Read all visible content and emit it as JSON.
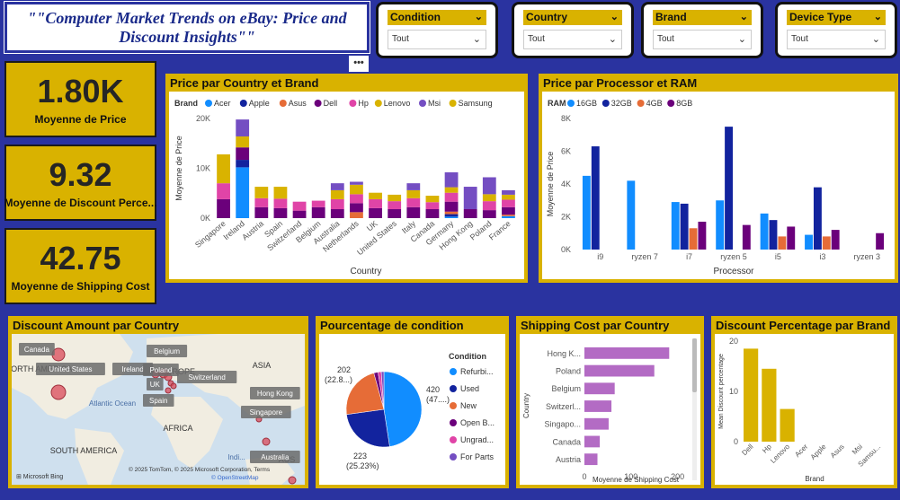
{
  "title": "\"\"Computer Market Trends on eBay: Price and Discount Insights\"\"",
  "slicers": [
    {
      "label": "Condition",
      "value": "Tout"
    },
    {
      "label": "Country",
      "value": "Tout"
    },
    {
      "label": "Brand",
      "value": "Tout"
    },
    {
      "label": "Device Type",
      "value": "Tout"
    }
  ],
  "more_options": "•••",
  "kpis": [
    {
      "value": "1.80K",
      "label": "Moyenne de Price"
    },
    {
      "value": "9.32",
      "label": "Moyenne de Discount Perce..."
    },
    {
      "value": "42.75",
      "label": "Moyenne de Shipping Cost"
    }
  ],
  "colors": {
    "accent": "#d9b200",
    "background": "#2a33a0",
    "Acer": "#118dff",
    "Apple": "#12239e",
    "Asus": "#e66c37",
    "Dell": "#6b007b",
    "Hp": "#e044a7",
    "Lenovo": "#d9b300",
    "Msi": "#744ec2",
    "Samsung": "#d9b300"
  },
  "chart_data": [
    {
      "id": "price-country-brand",
      "type": "bar",
      "stacked": true,
      "title": "Price par Country et Brand",
      "legend_title": "Brand",
      "legend_position": "top",
      "xlabel": "Country",
      "ylabel": "Moyenne de Price",
      "ylim": [
        0,
        20000
      ],
      "yticks": [
        "0K",
        "10K",
        "20K"
      ],
      "categories": [
        "Singapore",
        "Ireland",
        "Austria",
        "Spain",
        "Switzerland",
        "Belgium",
        "Australia",
        "Netherlands",
        "UK",
        "United States",
        "Italy",
        "Canada",
        "Germany",
        "Hong Kong",
        "Poland",
        "France"
      ],
      "series": [
        {
          "name": "Acer",
          "color": "#118dff",
          "values": [
            0,
            10200,
            0,
            0,
            0,
            0,
            0,
            0,
            0,
            0,
            0,
            0,
            300,
            0,
            0,
            400
          ]
        },
        {
          "name": "Apple",
          "color": "#12239e",
          "values": [
            0,
            1500,
            0,
            0,
            0,
            0,
            0,
            0,
            0,
            0,
            0,
            0,
            500,
            0,
            0,
            0
          ]
        },
        {
          "name": "Asus",
          "color": "#e66c37",
          "values": [
            0,
            0,
            0,
            0,
            0,
            0,
            0,
            1200,
            0,
            0,
            0,
            0,
            500,
            0,
            0,
            300
          ]
        },
        {
          "name": "Dell",
          "color": "#6b007b",
          "values": [
            3800,
            2500,
            2200,
            2000,
            1500,
            2200,
            1800,
            1800,
            2000,
            1800,
            2200,
            1800,
            2000,
            1800,
            1600,
            1500
          ]
        },
        {
          "name": "Hp",
          "color": "#e044a7",
          "values": [
            3200,
            0,
            1800,
            1900,
            1800,
            1300,
            2000,
            1800,
            1800,
            1600,
            1800,
            1400,
            1800,
            0,
            1800,
            1500
          ]
        },
        {
          "name": "Lenovo",
          "color": "#d9b300",
          "values": [
            5800,
            2200,
            2300,
            2400,
            0,
            0,
            1800,
            1900,
            1300,
            1300,
            1600,
            1300,
            1100,
            0,
            1400,
            1000
          ]
        },
        {
          "name": "Msi",
          "color": "#744ec2",
          "values": [
            0,
            3400,
            0,
            0,
            0,
            0,
            1400,
            600,
            0,
            0,
            1400,
            0,
            3000,
            4500,
            3400,
            900
          ]
        },
        {
          "name": "Samsung",
          "color": "#d9b300",
          "values": [
            0,
            0,
            0,
            0,
            0,
            0,
            0,
            0,
            0,
            0,
            0,
            0,
            0,
            0,
            0,
            0
          ]
        }
      ]
    },
    {
      "id": "price-processor-ram",
      "type": "bar",
      "title": "Price par Processor et RAM",
      "legend_title": "RAM",
      "legend_position": "top",
      "xlabel": "Processor",
      "ylabel": "Moyenne de Price",
      "ylim": [
        0,
        8000
      ],
      "yticks": [
        "0K",
        "2K",
        "4K",
        "6K",
        "8K"
      ],
      "categories": [
        "i9",
        "ryzen 7",
        "i7",
        "ryzen 5",
        "i5",
        "i3",
        "ryzen 3"
      ],
      "series": [
        {
          "name": "16GB",
          "color": "#118dff",
          "values": [
            4500,
            4200,
            2900,
            3000,
            2200,
            900,
            0
          ]
        },
        {
          "name": "32GB",
          "color": "#12239e",
          "values": [
            6300,
            0,
            2800,
            7500,
            1800,
            3800,
            0
          ]
        },
        {
          "name": "4GB",
          "color": "#e66c37",
          "values": [
            0,
            0,
            1300,
            0,
            800,
            800,
            0
          ]
        },
        {
          "name": "8GB",
          "color": "#6b007b",
          "values": [
            0,
            0,
            1700,
            1500,
            1400,
            1200,
            1000
          ]
        }
      ]
    },
    {
      "id": "discount-country-map",
      "type": "scatter",
      "title": "Discount Amount par Country",
      "map_labels": [
        "Canada",
        "United States",
        "Ireland",
        "Belgium",
        "Poland",
        "UK",
        "Switzerland",
        "Spain",
        "Hong Kong",
        "Singapore",
        "Australia"
      ],
      "region_labels": [
        "NORTH AMERICA",
        "EUROPE",
        "ASIA",
        "AFRICA",
        "SOUTH AMERICA",
        "Atlantic Ocean",
        "Indi...",
        "AUS"
      ],
      "attribution": "© 2025 TomTom, © 2025 Microsoft Corporation, Terms",
      "attribution2": "© OpenStreetMap",
      "brand": "Microsoft Bing"
    },
    {
      "id": "condition-pie",
      "type": "pie",
      "title": "Pourcentage de condition",
      "legend_title": "Condition",
      "legend_position": "right",
      "slices": [
        {
          "name": "Refurbi...",
          "value": 420,
          "pct_label": "420 (47....)",
          "color": "#118dff"
        },
        {
          "name": "Used",
          "value": 223,
          "pct_label": "223 (25.23%)",
          "color": "#12239e"
        },
        {
          "name": "New",
          "value": 202,
          "pct_label": "202 (22.8...)",
          "color": "#e66c37"
        },
        {
          "name": "Open B...",
          "value": 16,
          "pct_label": "",
          "color": "#6b007b"
        },
        {
          "name": "Ungrad...",
          "value": 12,
          "pct_label": "",
          "color": "#e044a7"
        },
        {
          "name": "For Parts",
          "value": 10,
          "pct_label": "",
          "color": "#744ec2"
        }
      ]
    },
    {
      "id": "shipping-country",
      "type": "bar",
      "orientation": "horizontal",
      "title": "Shipping Cost par Country",
      "xlabel": "Moyenne de Shipping Cost",
      "ylabel": "Country",
      "xlim": [
        0,
        220
      ],
      "xticks": [
        "0",
        "100",
        "200"
      ],
      "categories": [
        "Hong K...",
        "Poland",
        "Belgium",
        "Switzerl...",
        "Singapo...",
        "Canada",
        "Austria"
      ],
      "values": [
        182,
        150,
        65,
        58,
        52,
        33,
        28
      ],
      "color": "#b36bc4"
    },
    {
      "id": "discount-brand",
      "type": "bar",
      "title": "Discount Percentage par Brand",
      "xlabel": "Brand",
      "ylabel": "Mean Discount percentage",
      "ylim": [
        0,
        20
      ],
      "yticks": [
        "0",
        "10",
        "20"
      ],
      "categories": [
        "Dell",
        "Hp",
        "Lenovo",
        "Acer",
        "Apple",
        "Asus",
        "Msi",
        "Samsu..."
      ],
      "values": [
        18.5,
        14.5,
        6.5,
        0,
        0,
        0,
        0,
        0
      ],
      "color": "#d9b200"
    }
  ]
}
